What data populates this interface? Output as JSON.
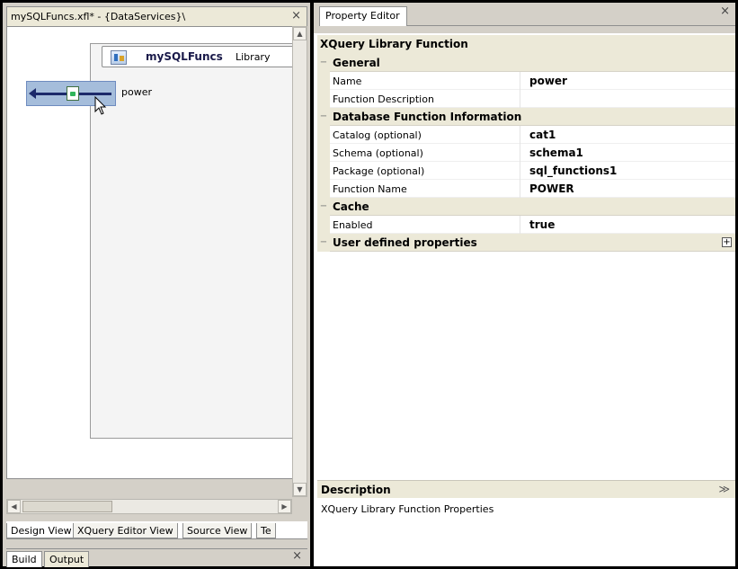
{
  "editor": {
    "tab_title": "mySQLFuncs.xfl* - {DataServices}\\",
    "close_glyph": "×",
    "library": {
      "name": "mySQLFuncs",
      "type_label": "Library",
      "icon": "library-icon"
    },
    "function_node": {
      "label": "power",
      "icon": "function-icon"
    },
    "scroll": {
      "up": "▲",
      "down": "▼",
      "left": "◀",
      "right": "▶"
    },
    "view_tabs": [
      "Design View",
      "XQuery Editor View",
      "Source View",
      "Te"
    ],
    "active_view_tab": "Design View"
  },
  "bottom_panel": {
    "tabs": [
      "Build",
      "Output"
    ],
    "active_tab": "Build",
    "close_glyph": "×"
  },
  "property_editor": {
    "tab_title": "Property Editor",
    "close_glyph": "×",
    "object_title": "XQuery Library Function",
    "categories": [
      {
        "label": "General",
        "toggle": "−",
        "properties": [
          {
            "name": "Name",
            "value": "power"
          },
          {
            "name": "Function Description",
            "value": ""
          }
        ]
      },
      {
        "label": "Database Function Information",
        "toggle": "−",
        "properties": [
          {
            "name": "Catalog (optional)",
            "value": "cat1"
          },
          {
            "name": "Schema (optional)",
            "value": "schema1"
          },
          {
            "name": "Package (optional)",
            "value": "sql_functions1"
          },
          {
            "name": "Function Name",
            "value": "POWER"
          }
        ]
      },
      {
        "label": "Cache",
        "toggle": "−",
        "properties": [
          {
            "name": "Enabled",
            "value": "true"
          }
        ]
      },
      {
        "label": "User defined properties",
        "toggle": "−",
        "expand_glyph": "+",
        "properties": []
      }
    ],
    "description": {
      "title": "Description",
      "collapse_glyph": "≫",
      "text": "XQuery Library Function Properties"
    }
  },
  "colors": {
    "selection_fill": "#a5bddb",
    "arrow": "#1c2a6b",
    "category_bg": "#ece9d8"
  }
}
